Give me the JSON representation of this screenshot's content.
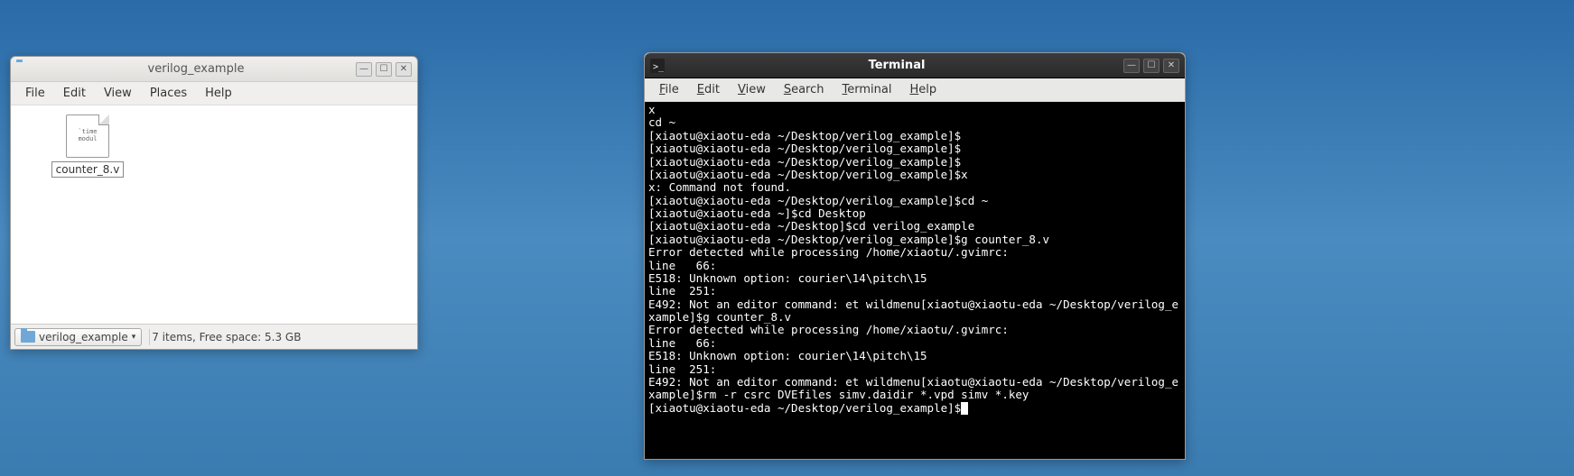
{
  "file_manager": {
    "title": "verilog_example",
    "menu": [
      "File",
      "Edit",
      "View",
      "Places",
      "Help"
    ],
    "file_icon_lines": [
      "`time",
      "modul"
    ],
    "file_name": "counter_8.v",
    "path_button": "verilog_example",
    "status": "7 items, Free space: 5.3 GB"
  },
  "terminal": {
    "title": "Terminal",
    "menu": [
      {
        "u": "F",
        "rest": "ile"
      },
      {
        "u": "E",
        "rest": "dit"
      },
      {
        "u": "V",
        "rest": "iew"
      },
      {
        "u": "S",
        "rest": "earch"
      },
      {
        "u": "T",
        "rest": "erminal"
      },
      {
        "u": "H",
        "rest": "elp"
      }
    ],
    "lines": [
      "x",
      "cd ~",
      "[xiaotu@xiaotu-eda ~/Desktop/verilog_example]$",
      "[xiaotu@xiaotu-eda ~/Desktop/verilog_example]$",
      "[xiaotu@xiaotu-eda ~/Desktop/verilog_example]$",
      "[xiaotu@xiaotu-eda ~/Desktop/verilog_example]$x",
      "x: Command not found.",
      "[xiaotu@xiaotu-eda ~/Desktop/verilog_example]$cd ~",
      "[xiaotu@xiaotu-eda ~]$cd Desktop",
      "[xiaotu@xiaotu-eda ~/Desktop]$cd verilog_example",
      "[xiaotu@xiaotu-eda ~/Desktop/verilog_example]$g counter_8.v",
      "Error detected while processing /home/xiaotu/.gvimrc:",
      "line   66:",
      "E518: Unknown option: courier\\14\\pitch\\15",
      "line  251:",
      "E492: Not an editor command: et wildmenu[xiaotu@xiaotu-eda ~/Desktop/verilog_example]$g counter_8.v",
      "Error detected while processing /home/xiaotu/.gvimrc:",
      "line   66:",
      "E518: Unknown option: courier\\14\\pitch\\15",
      "line  251:",
      "E492: Not an editor command: et wildmenu[xiaotu@xiaotu-eda ~/Desktop/verilog_example]$rm -r csrc DVEfiles simv.daidir *.vpd simv *.key",
      "[xiaotu@xiaotu-eda ~/Desktop/verilog_example]$"
    ]
  }
}
